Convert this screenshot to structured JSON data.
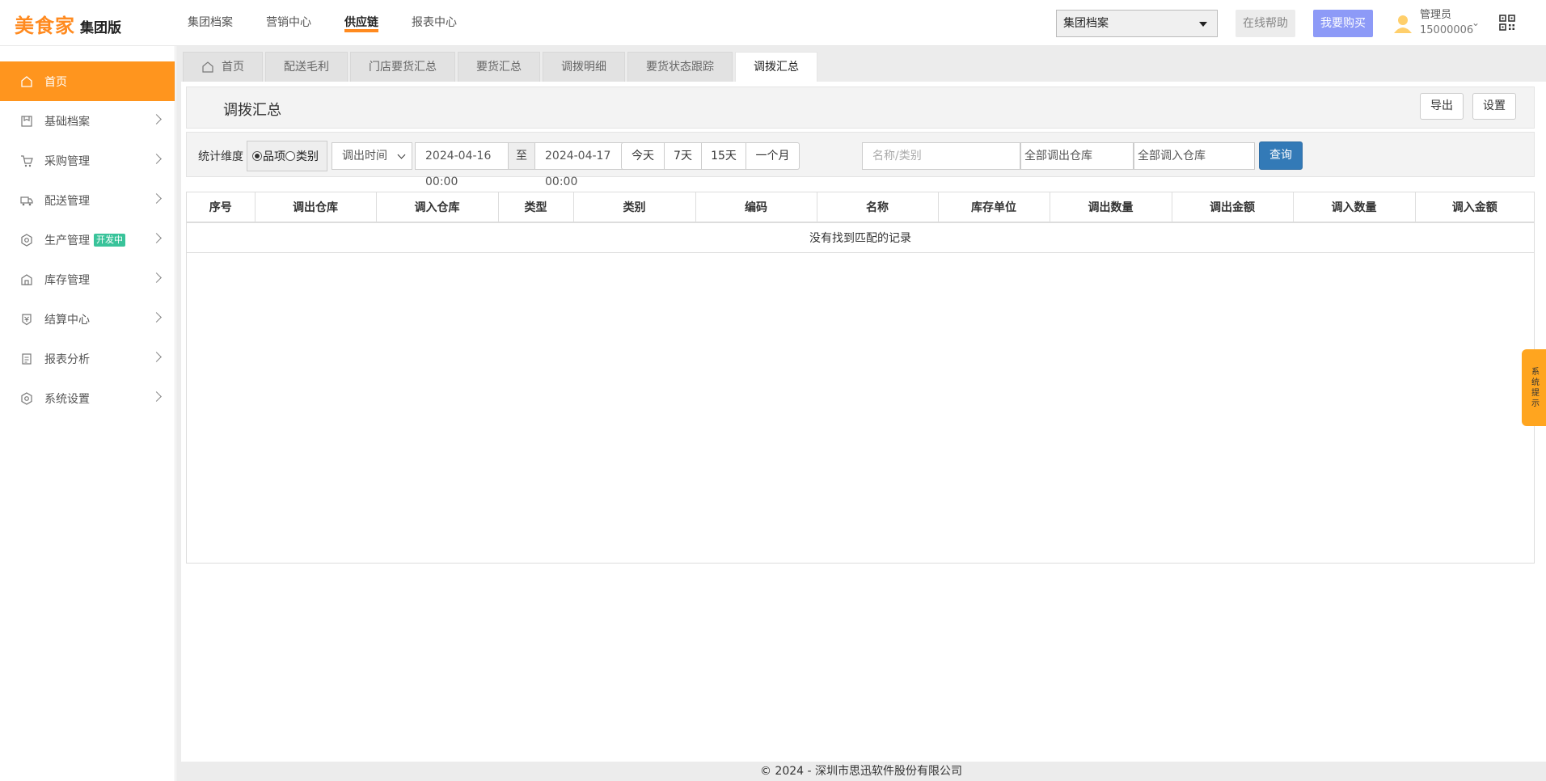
{
  "logo": {
    "main": "美食家",
    "sub": "集团版"
  },
  "topnav": [
    {
      "label": "集团档案"
    },
    {
      "label": "营销中心"
    },
    {
      "label": "供应链"
    },
    {
      "label": "报表中心"
    }
  ],
  "header": {
    "group_select": "集团档案",
    "help_label": "在线帮助",
    "buy_label": "我要购买",
    "user_name": "管理员",
    "user_id": "15000006"
  },
  "sidebar": {
    "items": [
      {
        "label": "首页"
      },
      {
        "label": "基础档案"
      },
      {
        "label": "采购管理"
      },
      {
        "label": "配送管理"
      },
      {
        "label": "生产管理",
        "badge": "开发中"
      },
      {
        "label": "库存管理"
      },
      {
        "label": "结算中心"
      },
      {
        "label": "报表分析"
      },
      {
        "label": "系统设置"
      }
    ]
  },
  "tabs": [
    {
      "label": "首页"
    },
    {
      "label": "配送毛利"
    },
    {
      "label": "门店要货汇总"
    },
    {
      "label": "要货汇总"
    },
    {
      "label": "调拨明细"
    },
    {
      "label": "要货状态跟踪"
    },
    {
      "label": "调拨汇总"
    }
  ],
  "page": {
    "title": "调拨汇总",
    "export_label": "导出",
    "settings_label": "设置"
  },
  "filters": {
    "dimension_label": "统计维度",
    "radio_item": "品项",
    "radio_category": "类别",
    "time_type": "调出时间",
    "date_from": "2024-04-16 00:00",
    "to_label": "至",
    "date_to": "2024-04-17 00:00",
    "quick": [
      "今天",
      "7天",
      "15天",
      "一个月"
    ],
    "search_placeholder": "名称/类别",
    "out_warehouse": "全部调出仓库",
    "in_warehouse": "全部调入仓库",
    "query_label": "查询"
  },
  "table": {
    "columns": [
      "序号",
      "调出仓库",
      "调入仓库",
      "类型",
      "类别",
      "编码",
      "名称",
      "库存单位",
      "调出数量",
      "调出金额",
      "调入数量",
      "调入金额"
    ],
    "empty_text": "没有找到匹配的记录"
  },
  "footer": {
    "text": "© 2024 - 深圳市思迅软件股份有限公司"
  },
  "sys_tip": {
    "label": "系统提示"
  },
  "colors": {
    "accent": "#ff951e",
    "primary": "#337ab7",
    "buy": "#8d9af7",
    "badge": "#39c39a"
  }
}
